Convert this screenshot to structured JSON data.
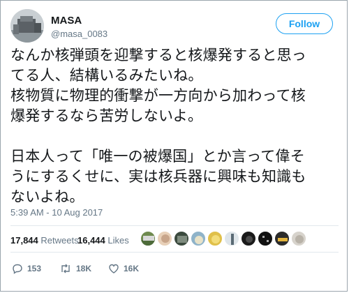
{
  "user": {
    "name": "MASA",
    "handle": "@masa_0083"
  },
  "follow_label": "Follow",
  "tweet": {
    "lines": [
      "なんか核弾頭を迎撃すると核爆発すると思っ",
      "てる人、結構いるみたいね。",
      "核物質に物理的衝撃が一方向から加わって核",
      "爆発するなら苦労しないよ。",
      "",
      "日本人って「唯一の被爆国」とか言って偉そ",
      "うにするくせに、実は核兵器に興味も知識も",
      "ないよね。"
    ],
    "timestamp": "5:39 AM - 10 Aug 2017"
  },
  "stats": {
    "retweets_count": "17,844",
    "retweets_label": "Retweets",
    "likes_count": "16,444",
    "likes_label": "Likes"
  },
  "actions": {
    "replies": "153",
    "retweets": "18K",
    "likes": "16K"
  },
  "colors": {
    "accent": "#1da1f2",
    "muted": "#657786",
    "text": "#14171a"
  }
}
